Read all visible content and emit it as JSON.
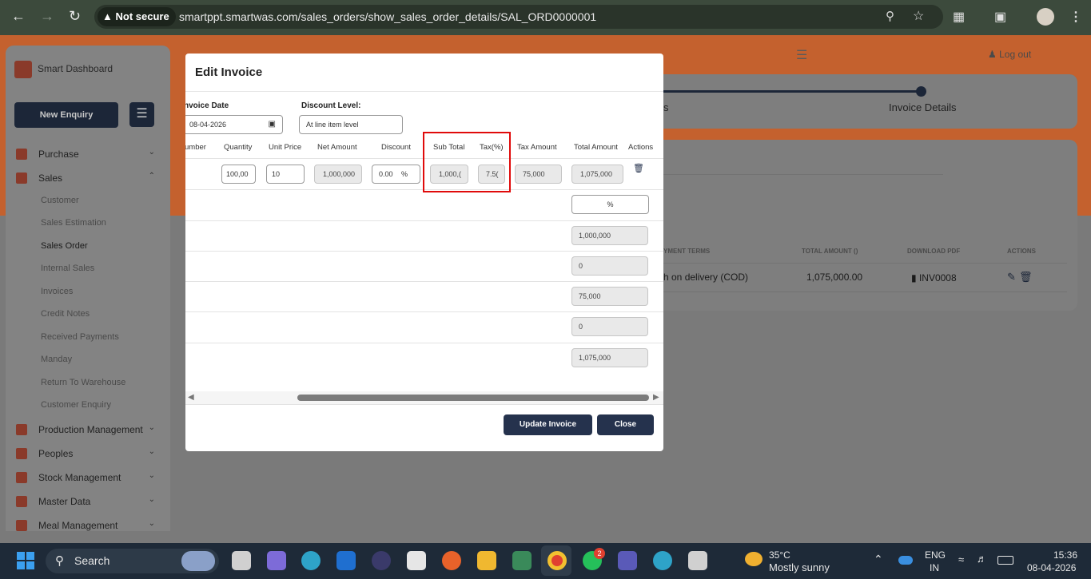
{
  "browser": {
    "security_badge": "Not secure",
    "url": "smartppt.smartwas.com/sales_orders/show_sales_order_details/SAL_ORD0000001"
  },
  "sidebar": {
    "brand": "Smart Dashboard",
    "new_enquiry": "New Enquiry",
    "sections": [
      {
        "label": "Purchase",
        "chevron": "⌄"
      },
      {
        "label": "Sales",
        "chevron": "⌃"
      },
      {
        "label": "Production Management",
        "chevron": "⌄"
      },
      {
        "label": "Peoples",
        "chevron": "⌄"
      },
      {
        "label": "Stock Management",
        "chevron": "⌄"
      },
      {
        "label": "Master Data",
        "chevron": "⌄"
      },
      {
        "label": "Meal Management",
        "chevron": "⌄"
      }
    ],
    "sales_items": [
      "Customer",
      "Sales Estimation",
      "Sales Order",
      "Internal Sales",
      "Invoices",
      "Credit Notes",
      "Received Payments",
      "Manday",
      "Return To Warehouse",
      "Customer Enquiry"
    ],
    "active_item": "Sales Order"
  },
  "header": {
    "logout": "Log out"
  },
  "background": {
    "step_fragment": "s",
    "step_label": "Invoice Details",
    "table_headers": [
      "YMENT TERMS",
      "TOTAL AMOUNT ()",
      "DOWNLOAD PDF",
      "ACTIONS"
    ],
    "row": {
      "terms": "h on delivery (COD)",
      "amount": "1,075,000.00",
      "pdf": "INV0008"
    }
  },
  "modal": {
    "title": "Edit Invoice",
    "invoice_date_label": "nvoice Date",
    "invoice_date_value": "08-04-2026",
    "discount_level_label": "Discount Level:",
    "discount_level_value": "At line item level",
    "columns": [
      "umber",
      "Quantity",
      "Unit Price",
      "Net Amount",
      "Discount",
      "Sub Total",
      "Tax(%)",
      "Tax Amount",
      "Total Amount",
      "Actions"
    ],
    "item": {
      "quantity": "100,00",
      "unit_price": "10",
      "net_amount": "1,000,000",
      "discount": "0.00",
      "discount_unit": "%",
      "sub_total": "1,000,(",
      "tax": "7.5(",
      "tax_amount": "75,000",
      "total_amount": "1,075,000"
    },
    "summary": {
      "discount_pct": "%",
      "subtotal": "1,000,000",
      "discount": "0",
      "tax": "75,000",
      "other": "0",
      "total": "1,075,000"
    },
    "update_button": "Update Invoice",
    "close_button": "Close"
  },
  "taskbar": {
    "search": "Search",
    "weather_temp": "35°C",
    "weather_desc": "Mostly sunny",
    "lang_top": "ENG",
    "lang_bottom": "IN",
    "time": "15:36",
    "date": "08-04-2026",
    "whatsapp_badge": "2"
  },
  "colors": {
    "brand_orange": "#c4612e",
    "navy": "#25324d",
    "highlight_red": "#e00b0b"
  }
}
